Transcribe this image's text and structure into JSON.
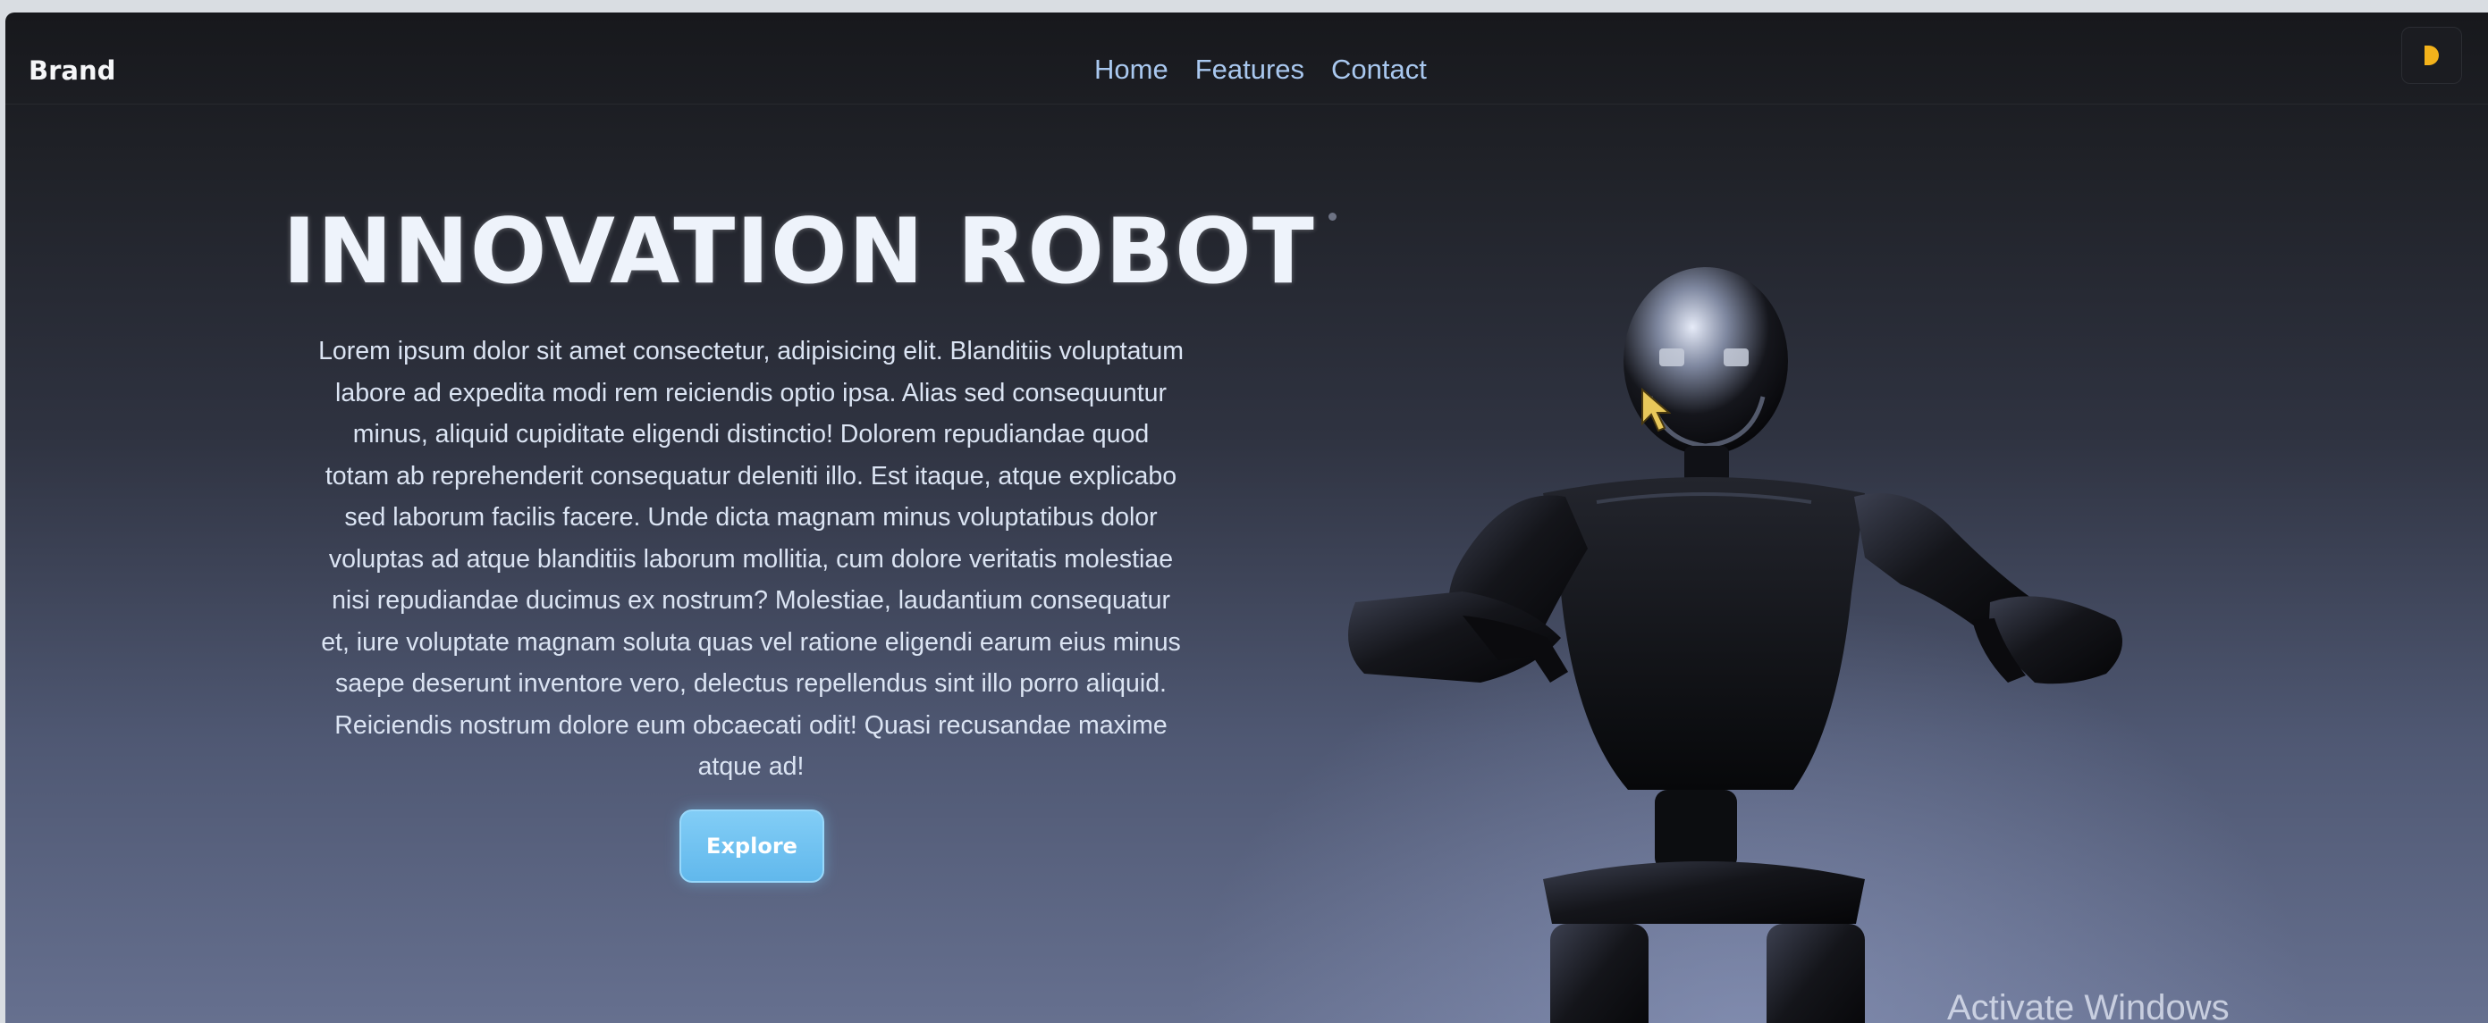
{
  "navbar": {
    "brand": "Brand",
    "links": [
      "Home",
      "Features",
      "Contact"
    ],
    "theme_toggle_icon": "half-moon-icon"
  },
  "hero": {
    "title": "INNOVATION ROBOT",
    "text": "Lorem ipsum dolor sit amet consectetur, adipisicing elit. Blanditiis voluptatum labore ad expedita modi rem reiciendis optio ipsa. Alias sed consequuntur minus, aliquid cupiditate eligendi distinctio! Dolorem repudiandae quod totam ab reprehenderit consequatur deleniti illo. Est itaque, atque explicabo sed laborum facilis facere. Unde dicta magnam minus voluptatibus dolor voluptas ad atque blanditiis laborum mollitia, cum dolore veritatis molestiae nisi repudiandae ducimus ex nostrum? Molestiae, laudantium consequatur et, iure voluptate magnam soluta quas vel ratione eligendi earum eius minus saepe deserunt inventore vero, delectus repellendus sint illo porro aliquid. Reiciendis nostrum dolore eum obcaecati odit! Quasi recusandae maxime atque ad!",
    "button_label": "Explore",
    "image_icon": "robot-illustration"
  },
  "watermark": "Activate Windows",
  "colors": {
    "accent_button": "#6ec1f0",
    "nav_link": "#a9c8ef",
    "theme_icon": "#f3b21b",
    "background_top": "#17181c",
    "background_bottom": "#66708f"
  }
}
